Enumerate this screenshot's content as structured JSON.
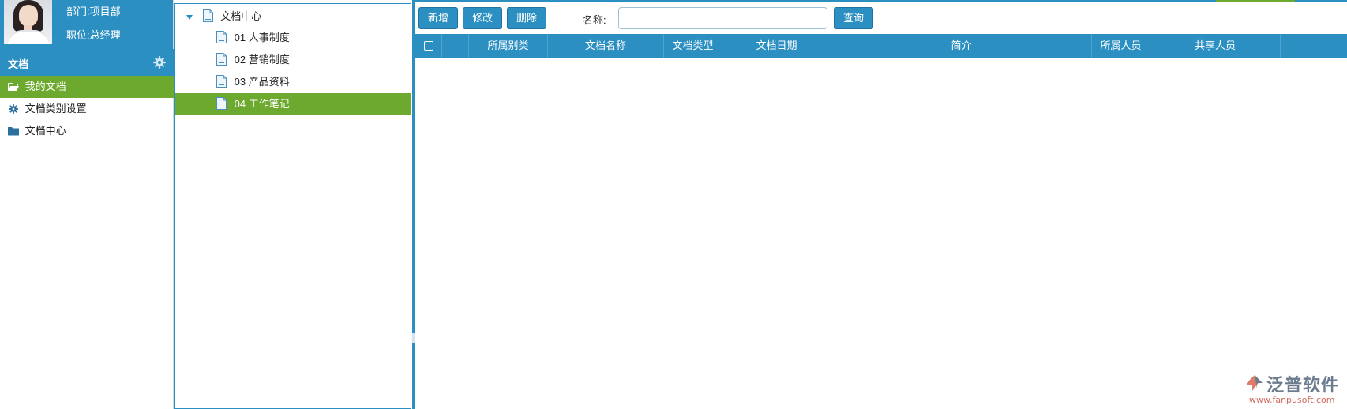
{
  "profile": {
    "department": "部门:项目部",
    "position": "职位:总经理"
  },
  "sidebar": {
    "section_title": "文档",
    "items": [
      {
        "label": "我的文档",
        "icon": "folder-open-icon",
        "active": true
      },
      {
        "label": "文档类别设置",
        "icon": "gear-icon",
        "active": false
      },
      {
        "label": "文档中心",
        "icon": "folder-icon",
        "active": false
      }
    ]
  },
  "tree": {
    "root": "文档中心",
    "children": [
      {
        "label": "01 人事制度",
        "selected": false
      },
      {
        "label": "02 营销制度",
        "selected": false
      },
      {
        "label": "03 产品资料",
        "selected": false
      },
      {
        "label": "04 工作笔记",
        "selected": true
      }
    ]
  },
  "toolbar": {
    "add_label": "新增",
    "edit_label": "修改",
    "delete_label": "删除",
    "name_label": "名称:",
    "name_value": "",
    "query_label": "查询"
  },
  "table": {
    "columns": [
      "",
      "所属别类",
      "文档名称",
      "文档类型",
      "文档日期",
      "简介",
      "所属人员",
      "共享人员"
    ],
    "rows": []
  },
  "watermark": {
    "brand": "泛普软件",
    "url": "www.fanpusoft.com"
  },
  "colors": {
    "primary": "#2b8fc2",
    "active": "#6ea92f",
    "brand_gray": "#6b7c8f",
    "brand_red": "#d06a5c"
  }
}
